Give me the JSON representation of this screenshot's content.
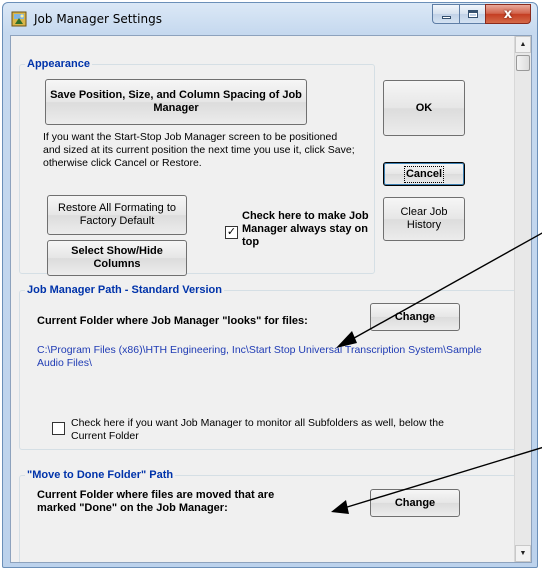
{
  "window": {
    "title": "Job Manager Settings",
    "close_glyph": "x"
  },
  "appearance": {
    "legend": "Appearance",
    "save_button": "Save Position, Size, and Column Spacing of Job Manager",
    "hint": "If you want the  Start-Stop  Job Manager screen to be positioned and sized at its current position the next time you use it, click Save; otherwise click Cancel or Restore.",
    "restore_button": "Restore All Formating to Factory Default",
    "select_columns_button": "Select Show/Hide Columns",
    "on_top_checked": true,
    "on_top_label": "Check here to make Job Manager always stay on top"
  },
  "side_buttons": {
    "ok": "OK",
    "cancel": "Cancel",
    "clear_history": "Clear Job History"
  },
  "path_group": {
    "legend": "Job Manager Path - Standard Version",
    "label": "Current Folder where Job Manager \"looks\" for files:",
    "change_button": "Change",
    "path": "C:\\Program Files (x86)\\HTH Engineering, Inc\\Start Stop Universal Transcription System\\Sample Audio Files\\",
    "subfolder_checked": false,
    "subfolder_label": "Check here if you want Job Manager to monitor all Subfolders as well,  below the Current Folder"
  },
  "done_group": {
    "legend": "\"Move to Done Folder\"  Path",
    "label": "Current Folder where files are moved that are marked \"Done\" on the Job Manager:",
    "change_button": "Change"
  },
  "colors": {
    "legend_blue": "#0033aa",
    "path_blue": "#1f3bb4",
    "title_bar": "#c6d9ef",
    "close_red": "#c43c22"
  }
}
